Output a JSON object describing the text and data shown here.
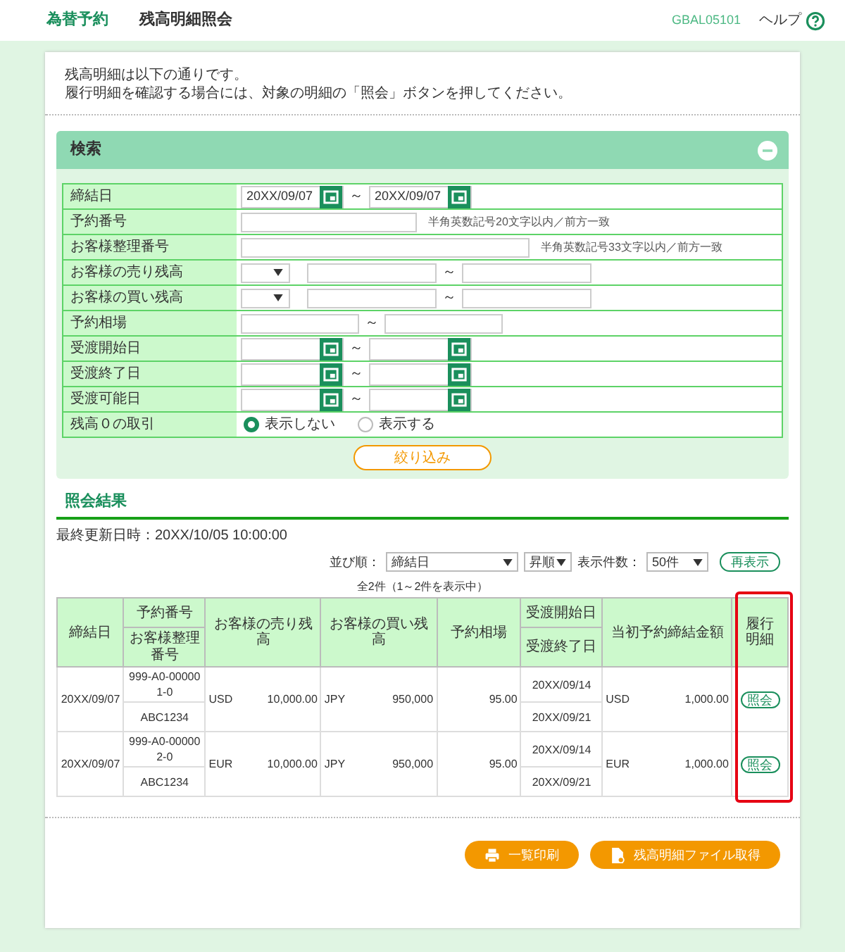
{
  "header": {
    "brand": "為替予約",
    "title": "残高明細照会",
    "screen_id": "GBAL05101",
    "help": "ヘルプ"
  },
  "intro": [
    "残高明細は以下の通りです。",
    "履行明細を確認する場合には、対象の明細の「照会」ボタンを押してください。"
  ],
  "search": {
    "title": "検索",
    "expanded": true,
    "submit": "絞り込み",
    "rows": [
      {
        "kind": "date_range",
        "label": "締結日",
        "from": "20XX/09/07",
        "to": "20XX/09/07",
        "sep": "～"
      },
      {
        "kind": "text",
        "label": "予約番号",
        "hint": "半角英数記号20文字以内／前方一致"
      },
      {
        "kind": "text_wide",
        "label": "お客様整理番号",
        "hint": "半角英数記号33文字以内／前方一致"
      },
      {
        "kind": "currency_range",
        "label": "お客様の売り残高",
        "sep": "～"
      },
      {
        "kind": "currency_range",
        "label": "お客様の買い残高",
        "sep": "～"
      },
      {
        "kind": "range",
        "label": "予約相場",
        "sep": "～"
      },
      {
        "kind": "date_range",
        "label": "受渡開始日",
        "sep": "～"
      },
      {
        "kind": "date_range",
        "label": "受渡終了日",
        "sep": "～"
      },
      {
        "kind": "date_range",
        "label": "受渡可能日",
        "sep": "～"
      },
      {
        "kind": "radio",
        "label": "残高０の取引",
        "options": [
          {
            "label": "表示しない",
            "selected": true
          },
          {
            "label": "表示する",
            "selected": false
          }
        ]
      }
    ]
  },
  "results": {
    "title": "照会結果",
    "updated": "最終更新日時：20XX/10/05 10:00:00",
    "sort_label": "並び順：",
    "sort_value": "締結日",
    "order_value": "昇順",
    "count_label": "表示件数：",
    "count_value": "50件",
    "redisplay": "再表示",
    "summary": "全2件（1～2件を表示中）",
    "columns": [
      "締結日",
      "予約番号",
      "お客様整理番号",
      "お客様の売り残高",
      "お客様の買い残高",
      "予約相場",
      "受渡開始日",
      "受渡終了日",
      "当初予約締結金額",
      "履行明細"
    ],
    "last_column_highlighted": true,
    "rows": [
      {
        "date": "20XX/09/07",
        "ref": "999-A0-000001-0",
        "cust_ref": "ABC1234",
        "sell_ccy": "USD",
        "sell_amt": "10,000.00",
        "buy_ccy": "JPY",
        "buy_amt": "950,000",
        "rate": "95.00",
        "start": "20XX/09/14",
        "end": "20XX/09/21",
        "init_ccy": "USD",
        "init_amt": "1,000.00",
        "action": "照会"
      },
      {
        "date": "20XX/09/07",
        "ref": "999-A0-000002-0",
        "cust_ref": "ABC1234",
        "sell_ccy": "EUR",
        "sell_amt": "10,000.00",
        "buy_ccy": "JPY",
        "buy_amt": "950,000",
        "rate": "95.00",
        "start": "20XX/09/14",
        "end": "20XX/09/21",
        "init_ccy": "EUR",
        "init_amt": "1,000.00",
        "action": "照会"
      }
    ]
  },
  "footer": {
    "print": "一覧印刷",
    "download": "残高明細ファイル取得"
  }
}
